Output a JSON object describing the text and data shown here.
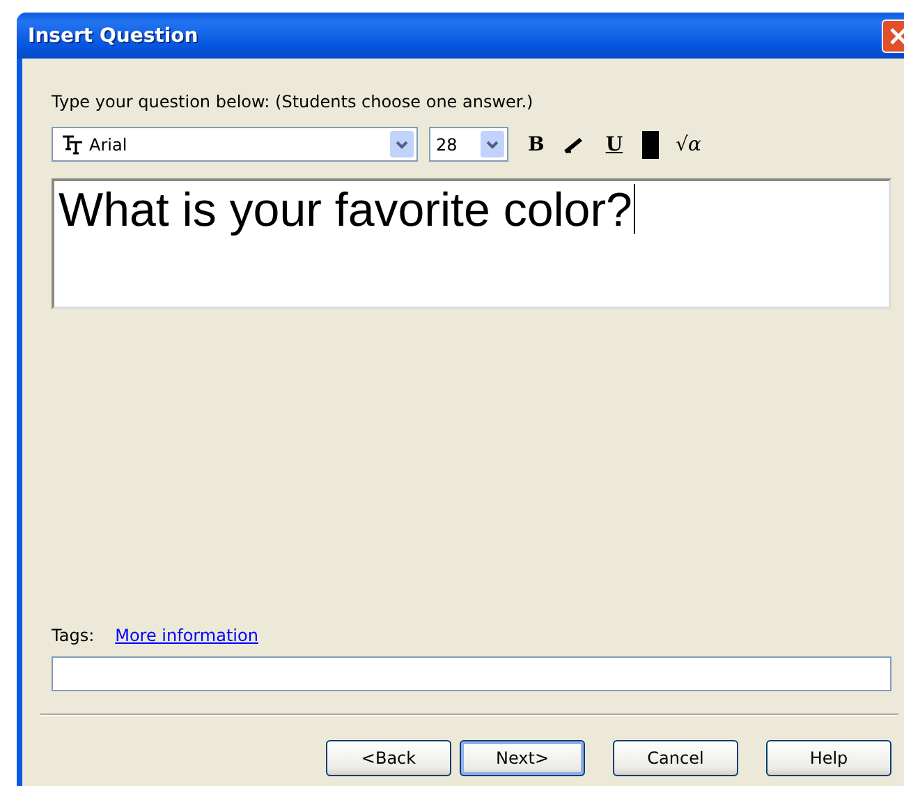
{
  "window": {
    "title": "Insert Question"
  },
  "instruction": "Type your question below: (Students choose one answer.)",
  "toolbar": {
    "font": {
      "value": "Arial"
    },
    "size": {
      "value": "28"
    },
    "buttons": [
      {
        "kind": "bold",
        "label": "B"
      },
      {
        "kind": "italic"
      },
      {
        "kind": "underline",
        "label": "U"
      },
      {
        "kind": "color",
        "color": "#000000"
      },
      {
        "kind": "equation",
        "label": "√α"
      }
    ]
  },
  "question": {
    "value": "What is your favorite color?"
  },
  "tags": {
    "label": "Tags:",
    "link": "More information"
  },
  "buttons": [
    {
      "label": "<Back",
      "default": false
    },
    {
      "label": "Next>",
      "default": true
    },
    {
      "label": "Cancel",
      "default": false
    },
    {
      "label": "Help",
      "default": false
    }
  ]
}
